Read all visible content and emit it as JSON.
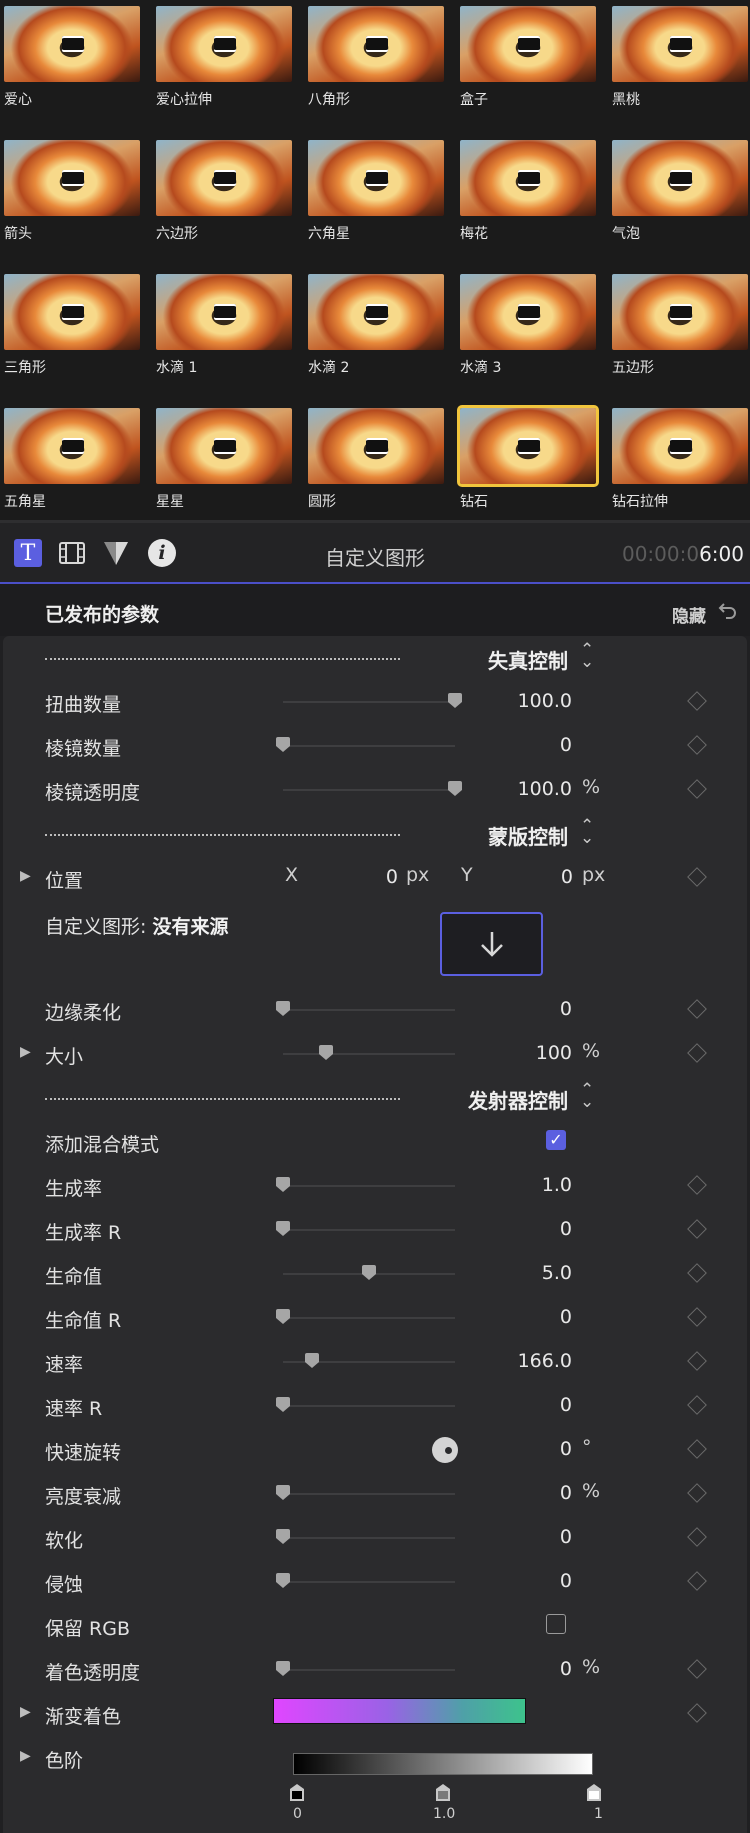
{
  "browser": {
    "rows": [
      [
        "爱心",
        "爱心拉伸",
        "八角形",
        "盒子",
        "黑桃"
      ],
      [
        "箭头",
        "六边形",
        "六角星",
        "梅花",
        "气泡"
      ],
      [
        "三角形",
        "水滴 1",
        "水滴 2",
        "水滴 3",
        "五边形"
      ],
      [
        "五角星",
        "星星",
        "圆形",
        "钻石",
        "钻石拉伸"
      ]
    ],
    "selected": "钻石"
  },
  "toolbar": {
    "title": "自定义图形",
    "timecode_dim": "00:00:0",
    "timecode_bright": "6:00"
  },
  "inspector": {
    "header_title": "已发布的参数",
    "hide_label": "隐藏"
  },
  "sections": {
    "distortion": "失真控制",
    "mask": "蒙版控制",
    "emitter": "发射器控制"
  },
  "params": {
    "twist": {
      "label": "扭曲数量",
      "value": "100.0",
      "level": 1.0
    },
    "prism_amount": {
      "label": "棱镜数量",
      "value": "0",
      "level": 0
    },
    "prism_opacity": {
      "label": "棱镜透明度",
      "value": "100.0",
      "unit": "%",
      "level": 1.0
    },
    "position": {
      "label": "位置",
      "x_label": "X",
      "x_value": "0",
      "x_unit": "px",
      "y_label": "Y",
      "y_value": "0",
      "y_unit": "px"
    },
    "custom_shape": {
      "label": "自定义图形:",
      "source": "没有来源"
    },
    "feather": {
      "label": "边缘柔化",
      "value": "0",
      "level": 0
    },
    "size": {
      "label": "大小",
      "value": "100",
      "unit": "%",
      "level": 0.25
    },
    "additive_blend": {
      "label": "添加混合模式",
      "checked": true
    },
    "birth_rate": {
      "label": "生成率",
      "value": "1.0",
      "level": 0
    },
    "birth_rate_r": {
      "label": "生成率 R",
      "value": "0",
      "level": 0
    },
    "life": {
      "label": "生命值",
      "value": "5.0",
      "level": 0.5
    },
    "life_r": {
      "label": "生命值 R",
      "value": "0",
      "level": 0
    },
    "speed": {
      "label": "速率",
      "value": "166.0",
      "level": 0.17
    },
    "speed_r": {
      "label": "速率 R",
      "value": "0",
      "level": 0
    },
    "spin": {
      "label": "快速旋转",
      "value": "0",
      "unit": "°"
    },
    "brightness_decay": {
      "label": "亮度衰减",
      "value": "0",
      "unit": "%",
      "level": 0
    },
    "soften": {
      "label": "软化",
      "value": "0",
      "level": 0
    },
    "erode": {
      "label": "侵蚀",
      "value": "0",
      "level": 0
    },
    "preserve_rgb": {
      "label": "保留 RGB",
      "checked": false
    },
    "tint_opacity": {
      "label": "着色透明度",
      "value": "0",
      "unit": "%",
      "level": 0
    },
    "gradient_tint": {
      "label": "渐变着色"
    },
    "levels": {
      "label": "色阶",
      "black": "0",
      "gray": "1.0",
      "white": "1"
    }
  },
  "colors": {
    "accent": "#5b5fe0",
    "selection": "#f1c53d",
    "gradient_start": "#e046ff",
    "gradient_end": "#3dc38c"
  },
  "icons": [
    "text-inspector-icon",
    "film-icon",
    "filter-icon",
    "info-icon",
    "undo-icon",
    "chevron-updown-icon",
    "disclosure-triangle-icon",
    "keyframe-diamond-icon",
    "down-arrow-icon",
    "checkmark-icon"
  ]
}
